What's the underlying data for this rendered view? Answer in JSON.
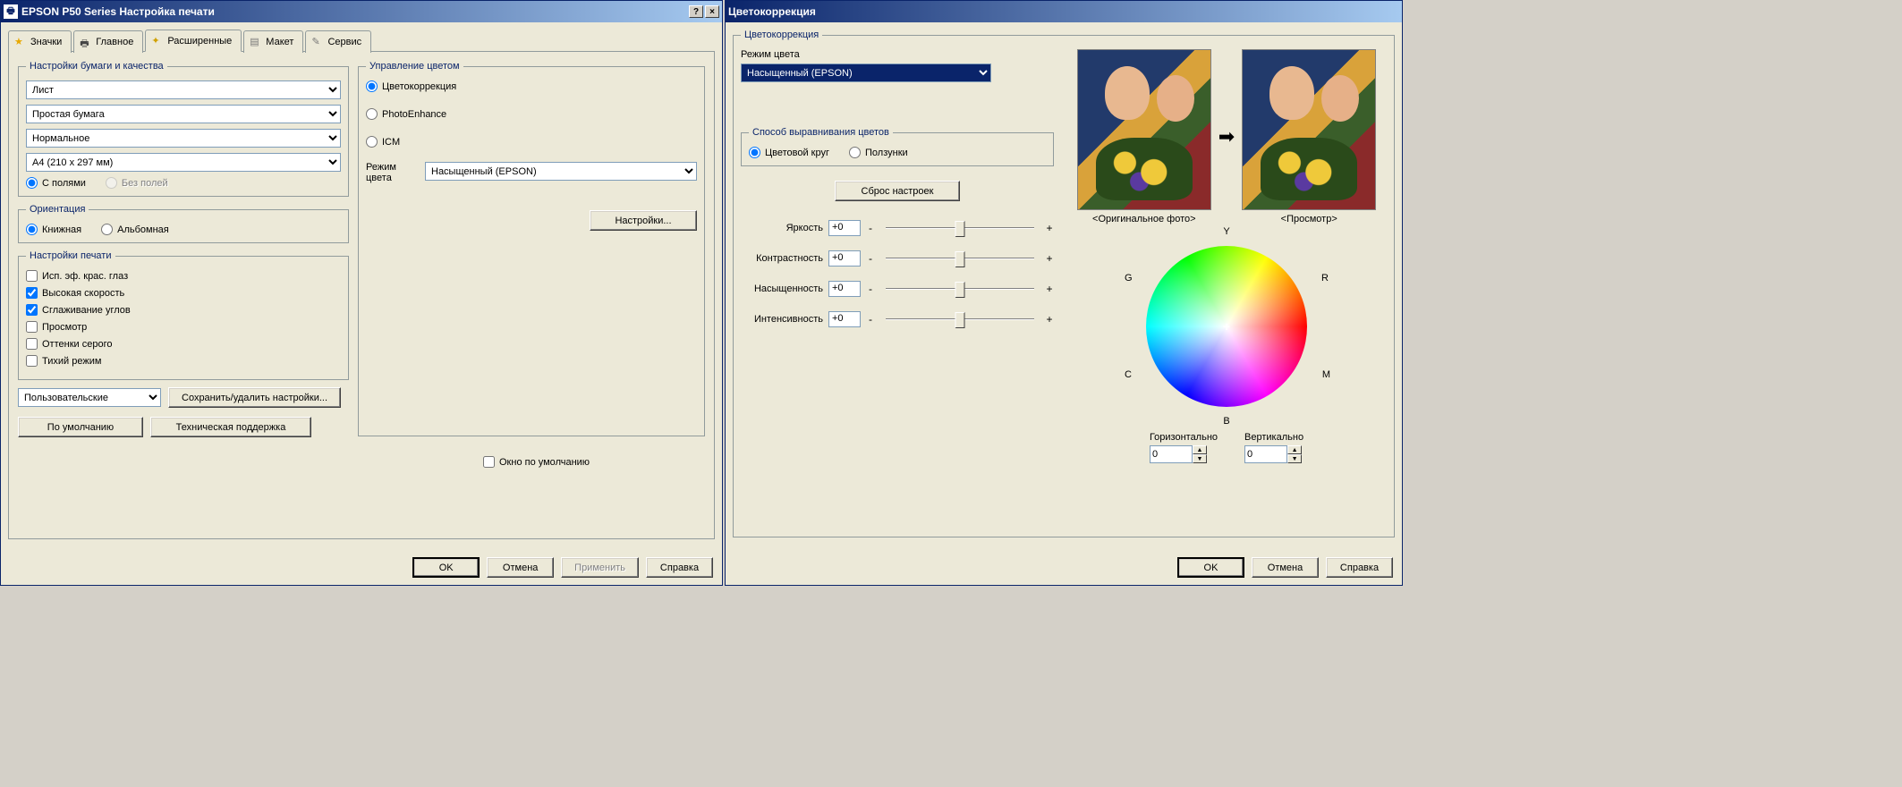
{
  "win1": {
    "title": "EPSON P50 Series Настройка печати",
    "help": "?",
    "close": "×",
    "tabs": {
      "shortcuts": "Значки",
      "main": "Главное",
      "advanced": "Расширенные",
      "layout": "Макет",
      "service": "Сервис"
    },
    "paper": {
      "legend": "Настройки бумаги и качества",
      "source": "Лист",
      "media": "Простая бумага",
      "quality": "Нормальное",
      "size": "A4 (210 x 297 мм)",
      "borders_with": "С полями",
      "borders_without": "Без полей"
    },
    "orient": {
      "legend": "Ориентация",
      "portrait": "Книжная",
      "landscape": "Альбомная"
    },
    "printopts": {
      "legend": "Настройки печати",
      "redeye": "Исп. эф. крас. глаз",
      "highspeed": "Высокая скорость",
      "smoothing": "Сглаживание углов",
      "preview": "Просмотр",
      "grayscale": "Оттенки серого",
      "quiet": "Тихий режим"
    },
    "color": {
      "legend": "Управление цветом",
      "corr": "Цветокоррекция",
      "photoenhance": "PhotoEnhance",
      "icm": "ICM",
      "mode_label": "Режим цвета",
      "mode_value": "Насыщенный (EPSON)",
      "settings_btn": "Настройки..."
    },
    "preset": "Пользовательские",
    "save_settings": "Сохранить/удалить настройки...",
    "default_window": "Окно по умолчанию",
    "defaults_btn": "По умолчанию",
    "support_btn": "Техническая поддержка",
    "ok": "OK",
    "cancel": "Отмена",
    "apply": "Применить",
    "help_btn": "Справка"
  },
  "win2": {
    "title": "Цветокоррекция",
    "group": "Цветокоррекция",
    "mode_label": "Режим цвета",
    "mode_value": "Насыщенный (EPSON)",
    "align": {
      "legend": "Способ выравнивания цветов",
      "wheel": "Цветовой круг",
      "sliders": "Ползунки"
    },
    "reset": "Сброс настроек",
    "sliders": {
      "brightness": {
        "label": "Яркость",
        "value": "+0"
      },
      "contrast": {
        "label": "Контрастность",
        "value": "+0"
      },
      "saturation": {
        "label": "Насыщенность",
        "value": "+0"
      },
      "intensity": {
        "label": "Интенсивность",
        "value": "+0"
      }
    },
    "wheel_labels": {
      "Y": "Y",
      "R": "R",
      "M": "M",
      "B": "B",
      "C": "C",
      "G": "G"
    },
    "preview": {
      "original": "<Оригинальное фото>",
      "preview": "<Просмотр>"
    },
    "spin": {
      "horiz_label": "Горизонтально",
      "horiz_value": "0",
      "vert_label": "Вертикально",
      "vert_value": "0"
    },
    "ok": "OK",
    "cancel": "Отмена",
    "help": "Справка"
  }
}
